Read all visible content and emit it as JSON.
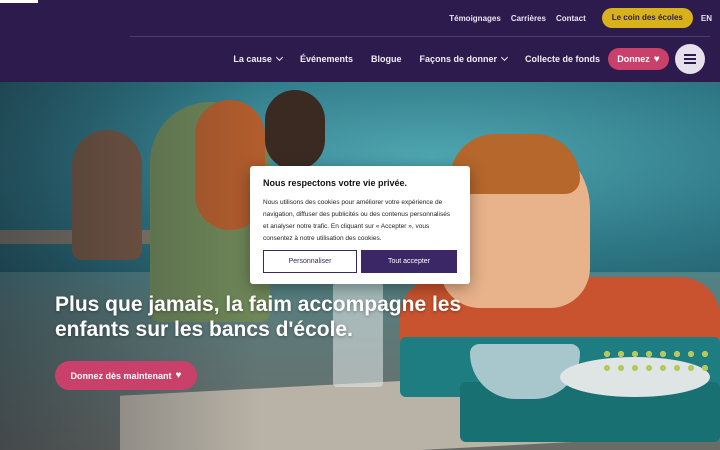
{
  "header": {
    "top_links": [
      "Témoignages",
      "Carrières",
      "Contact"
    ],
    "schools_button": "Le coin des écoles",
    "language": "EN",
    "nav": [
      {
        "label": "La cause",
        "dropdown": true
      },
      {
        "label": "Événements",
        "dropdown": false
      },
      {
        "label": "Blogue",
        "dropdown": false
      },
      {
        "label": "Façons de donner",
        "dropdown": true
      },
      {
        "label": "Collecte de fonds",
        "dropdown": false
      }
    ],
    "donate_label": "Donnez",
    "icons": [
      "heart-icon",
      "hamburger-menu-icon",
      "chevron-down-icon"
    ]
  },
  "hero": {
    "title": "Plus que jamais, la faim accompagne les enfants sur les bancs d'école.",
    "cta_label": "Donnez dès maintenant"
  },
  "cookie": {
    "title": "Nous respectons votre vie privée.",
    "text": "Nous utilisons des cookies pour améliorer votre expérience de navigation, diffuser des publicités ou des contenus personnalisés et analyser notre trafic. En cliquant sur « Accepter », vous consentez à notre utilisation des cookies.",
    "customize_label": "Personnaliser",
    "accept_label": "Tout accepter"
  },
  "colors": {
    "header_bg": "#2d1b4e",
    "accent_pink": "#c9416a",
    "accent_yellow": "#d8b21a",
    "button_purple": "#3b2766"
  }
}
